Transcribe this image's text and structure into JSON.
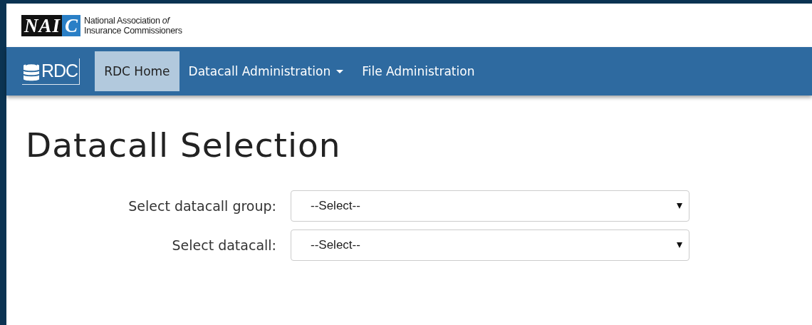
{
  "header": {
    "logo_mark": [
      "NAI",
      "C"
    ],
    "org_name": [
      "National Association *of*",
      "Insurance Commissioners"
    ]
  },
  "navbar": {
    "brand": "RDC",
    "items": [
      {
        "label": "RDC Home",
        "kind": "link",
        "selected": true
      },
      {
        "label": "Datacall Administration",
        "kind": "dropdown",
        "selected": false
      },
      {
        "label": "File Administration",
        "kind": "link",
        "selected": false
      }
    ]
  },
  "page": {
    "title": "Datacall Selection",
    "fields": [
      {
        "label": "Select datacall group:",
        "value": "--Select--"
      },
      {
        "label": "Select datacall:",
        "value": "--Select--"
      }
    ]
  }
}
